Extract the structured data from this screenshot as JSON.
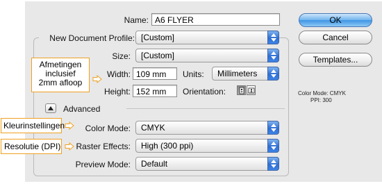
{
  "dialog": {
    "name_label": "Name:",
    "name_value": "A6 FLYER",
    "profile_label": "New Document Profile:",
    "profile_value": "[Custom]",
    "size_label": "Size:",
    "size_value": "[Custom]",
    "width_label": "Width:",
    "width_value": "109 mm",
    "units_label": "Units:",
    "units_value": "Millimeters",
    "height_label": "Height:",
    "height_value": "152 mm",
    "orientation_label": "Orientation:",
    "advanced_label": "Advanced",
    "color_mode_label": "Color Mode:",
    "color_mode_value": "CMYK",
    "raster_label": "Raster Effects:",
    "raster_value": "High (300 ppi)",
    "preview_label": "Preview Mode:",
    "preview_value": "Default"
  },
  "buttons": {
    "ok": "OK",
    "cancel": "Cancel",
    "templates": "Templates..."
  },
  "info": {
    "color_mode": "Color Mode: CMYK",
    "ppi": "PPI: 300"
  },
  "callouts": {
    "dimensions_line1": "Afmetingen",
    "dimensions_line2": "inclusief",
    "dimensions_line3": "2mm afloop",
    "color_settings": "Kleurinstellingen",
    "resolution": "Resolutie (DPI)"
  },
  "colors": {
    "callout_border": "#f0a020",
    "dialog_bg": "#e8e8e8",
    "accent": "#3f84e5"
  }
}
